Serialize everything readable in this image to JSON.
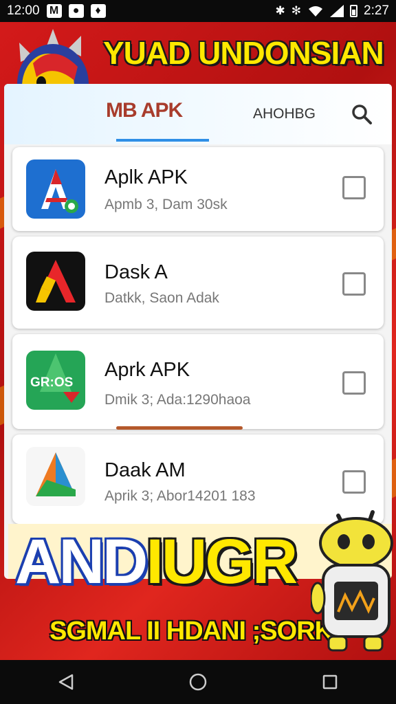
{
  "status_bar": {
    "time_left": "12:00",
    "notif_icons": [
      "M",
      "chat",
      "shield"
    ],
    "time_right": "2:27"
  },
  "banner": {
    "headline": "YUAD UNDONSIAN"
  },
  "app_header": {
    "active_tab": "MB APK",
    "second_tab": "AHOHBG"
  },
  "apps": [
    {
      "name": "Aplk APK",
      "subtitle": "Apmb 3, Dam 30sk",
      "checked": false
    },
    {
      "name": "Dask A",
      "subtitle": "Datkk, Saon Adak",
      "checked": false
    },
    {
      "name": "Aprk APK",
      "subtitle": "Dmik 3; Ada:1290haoa",
      "checked": false
    },
    {
      "name": "Daak AM",
      "subtitle": "Aprik 3; Abor14201 183",
      "checked": false
    }
  ],
  "promo": {
    "title_part1": "AND",
    "title_part2": "IUGR",
    "subtitle": "SGMAL II  HDANI ;SORK"
  },
  "colors": {
    "banner_red": "#d41a1a",
    "headline_yellow": "#ffe800",
    "tab_active": "#a83c2c",
    "tab_underline": "#2f8fe6"
  }
}
